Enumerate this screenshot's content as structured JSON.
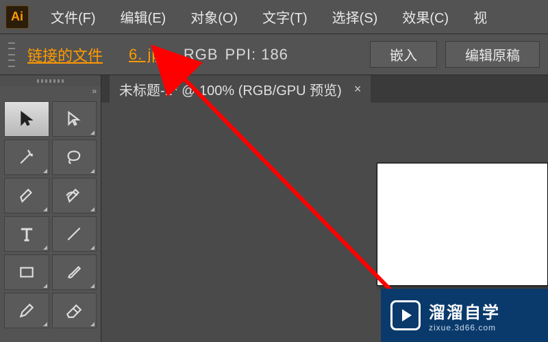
{
  "app": {
    "logo": "Ai"
  },
  "menu": {
    "file": "文件(F)",
    "edit": "编辑(E)",
    "object": "对象(O)",
    "type": "文字(T)",
    "select": "选择(S)",
    "effect": "效果(C)",
    "view_partial": "视"
  },
  "control": {
    "linked_label": "链接的文件",
    "filename": "6. jpg",
    "colormode": "RGB",
    "ppi_label": "PPI: 186",
    "embed_btn": "嵌入",
    "edit_original_btn": "编辑原稿"
  },
  "document": {
    "tab_label": "未标题-1* @ 100% (RGB/GPU 预览)",
    "close": "×"
  },
  "tools": [
    {
      "name": "selection-tool",
      "sel": true
    },
    {
      "name": "direct-selection-tool"
    },
    {
      "name": "magic-wand-tool"
    },
    {
      "name": "lasso-tool"
    },
    {
      "name": "pen-tool"
    },
    {
      "name": "curvature-tool"
    },
    {
      "name": "type-tool"
    },
    {
      "name": "line-segment-tool"
    },
    {
      "name": "rectangle-tool"
    },
    {
      "name": "paintbrush-tool"
    },
    {
      "name": "pencil-tool"
    },
    {
      "name": "eraser-tool"
    }
  ],
  "watermark": {
    "title": "溜溜自学",
    "url": "zixue.3d66.com"
  }
}
